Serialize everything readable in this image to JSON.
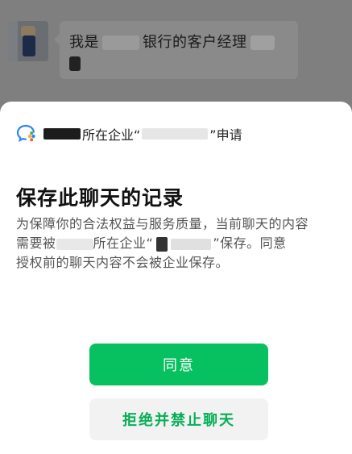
{
  "chat": {
    "message_prefix": "我是",
    "message_suffix": "银行的客户经理"
  },
  "sheet": {
    "request_mid": "所在企业“",
    "request_end": "”申请",
    "title": "保存此聊天的记录",
    "desc_line1": "为保障你的合法权益与服务质量，当前聊天的内容",
    "desc_line2_a": "需要被",
    "desc_line2_b": "所在企业“",
    "desc_line2_c": "”保存。同意",
    "desc_line3": "授权前的聊天内容不会被企业保存。",
    "agree_label": "同意",
    "reject_label": "拒绝并禁止聊天"
  },
  "colors": {
    "accent_green": "#07c160",
    "reject_text": "#06ae56"
  },
  "icons": {
    "wecom": "wecom-logo-icon"
  }
}
